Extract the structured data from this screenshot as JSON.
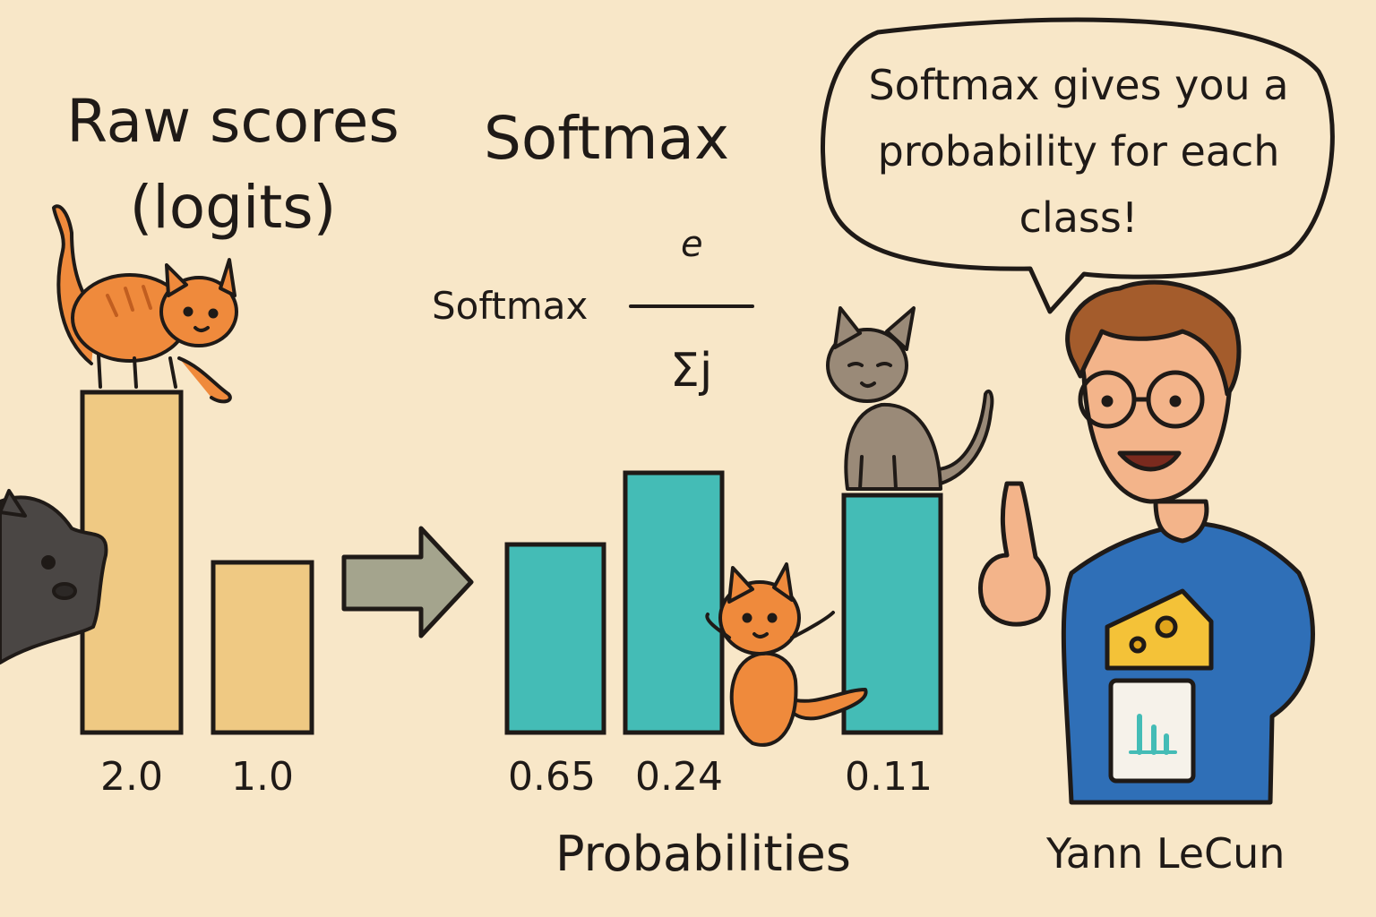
{
  "colors": {
    "background": "#f8e7c8",
    "raw_bar": "#efc983",
    "prob_bar": "#44bcb6",
    "outline": "#1f1a17",
    "arrow": "#a4a48d",
    "orange_cat": "#ef8a3c",
    "gray_cat": "#9a8a78",
    "shirt": "#2f6fb7",
    "cheese": "#f4c238"
  },
  "raw_section": {
    "title_line1": "Raw scores",
    "title_line2": "(logits)",
    "values": [
      "2.0",
      "1.0"
    ]
  },
  "softmax_section": {
    "title": "Softmax",
    "formula_label": "Softmax",
    "formula_numerator": "e",
    "formula_denominator": "Σj",
    "values": [
      "0.65",
      "0.24",
      "0.11"
    ],
    "xlabel": "Probabilities"
  },
  "speech_bubble": {
    "text": "Softmax gives you a probability for each class!"
  },
  "person": {
    "name": "Yann LeCun"
  },
  "icons": [
    "arrow-right-icon",
    "orange-cat-icon",
    "gray-cat-icon",
    "black-cat-icon",
    "cheese-icon",
    "chart-card-icon"
  ],
  "chart_data": [
    {
      "type": "bar",
      "title": "Raw scores (logits)",
      "categories": [
        "",
        ""
      ],
      "values": [
        2.0,
        1.0
      ],
      "value_labels": [
        "2.0",
        "1.0"
      ]
    },
    {
      "type": "bar",
      "title": "Softmax",
      "xlabel": "Probabilities",
      "categories": [
        "",
        "",
        ""
      ],
      "values": [
        0.65,
        0.24,
        0.11
      ],
      "value_labels": [
        "0.65",
        "0.24",
        "0.11"
      ]
    }
  ]
}
